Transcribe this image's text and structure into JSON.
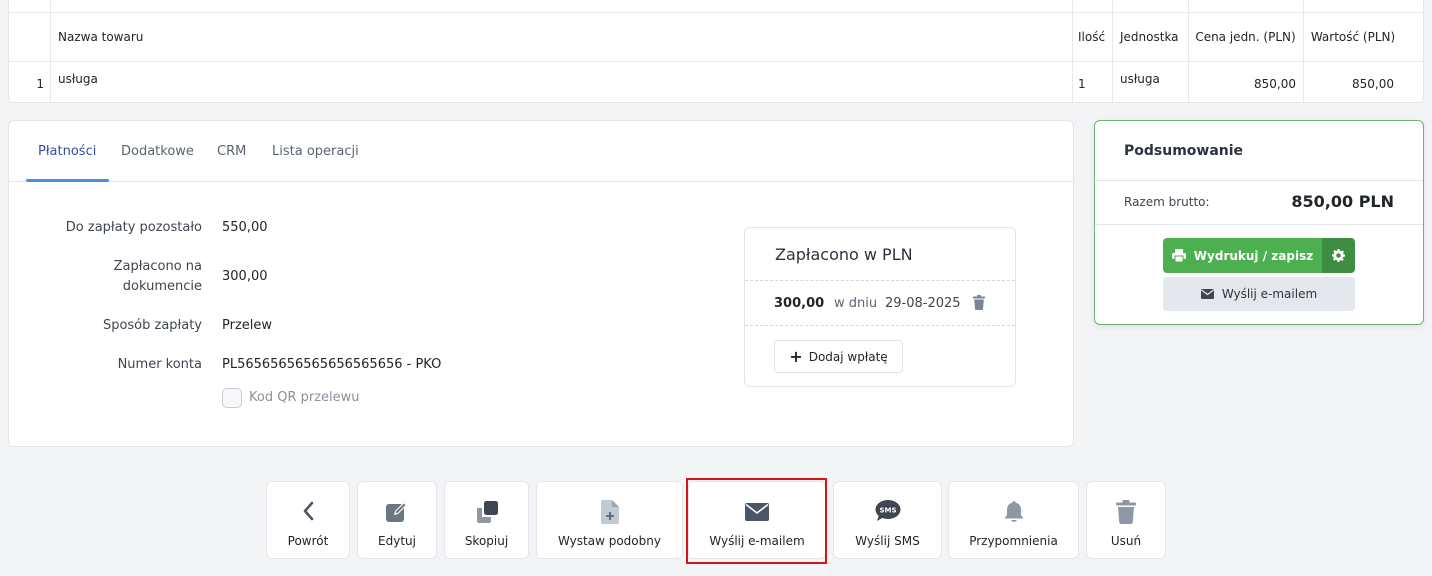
{
  "items_table": {
    "headers": {
      "name": "Nazwa towaru",
      "qty": "Ilość",
      "unit": "Jednostka",
      "unit_price": "Cena jedn. (PLN)",
      "value": "Wartość (PLN)"
    },
    "rows": [
      {
        "lp": "1",
        "name": "usługa",
        "qty": "1",
        "unit": "usługa",
        "unit_price": "850,00",
        "value": "850,00"
      }
    ]
  },
  "tabs": [
    "Płatności",
    "Dodatkowe",
    "CRM",
    "Lista operacji"
  ],
  "payments": {
    "remaining_label": "Do zapłaty pozostało",
    "remaining_value": "550,00",
    "paid_label_1": "Zapłacono na",
    "paid_label_2": "dokumencie",
    "paid_value": "300,00",
    "method_label": "Sposób zapłaty",
    "method_value": "Przelew",
    "account_label": "Numer konta",
    "account_value": "PL56565656565656565656 - PKO",
    "qr_label": "Kod QR przelewu",
    "qr_checked": false
  },
  "paid_box": {
    "title": "Zapłacono w PLN",
    "amount": "300,00",
    "on_label": "w dniu",
    "date": "29-08-2025",
    "add_label": "Dodaj wpłatę"
  },
  "summary": {
    "title": "Podsumowanie",
    "total_label": "Razem brutto:",
    "total_value": "850,00 PLN",
    "print_label": "Wydrukuj / zapisz",
    "email_label": "Wyślij e-mailem"
  },
  "actions": {
    "back": "Powrót",
    "edit": "Edytuj",
    "copy": "Skopiuj",
    "similar": "Wystaw podobny",
    "email": "Wyślij e-mailem",
    "sms": "Wyślij SMS",
    "reminders": "Przypomnienia",
    "delete": "Usuń"
  },
  "colors": {
    "accent_green": "#4caf50",
    "tab_active": "#2f4fa8",
    "highlight_red": "#d0161d"
  }
}
